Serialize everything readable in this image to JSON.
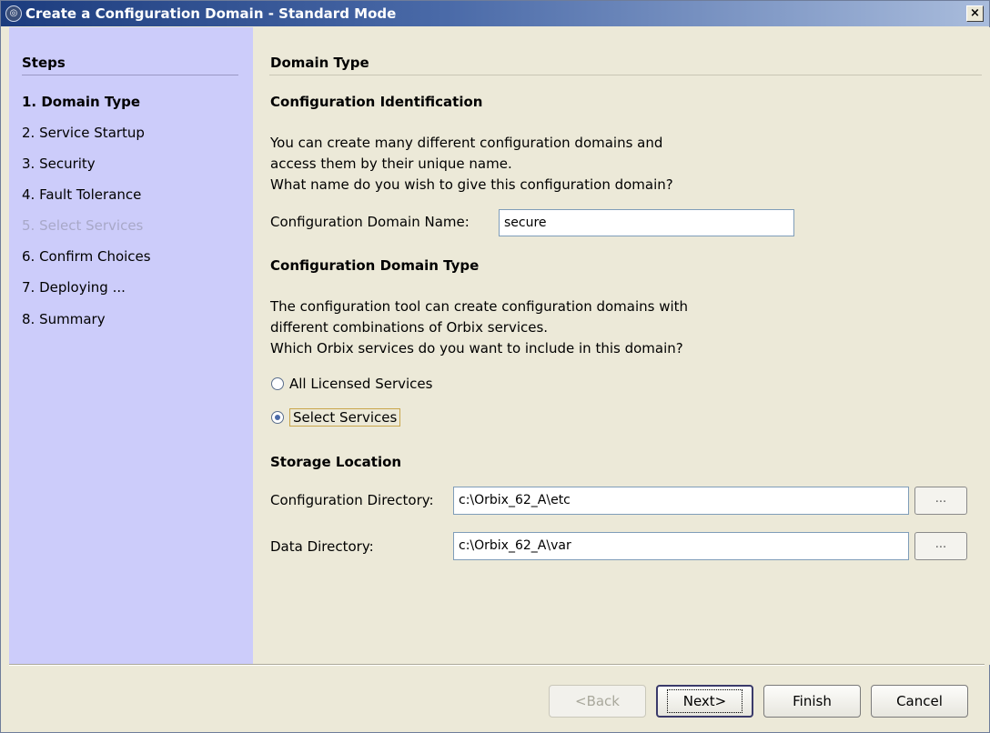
{
  "window": {
    "title": "Create a Configuration Domain - Standard Mode",
    "close_label": "×"
  },
  "sidebar": {
    "heading": "Steps",
    "steps": [
      {
        "label": "1. Domain Type",
        "state": "active"
      },
      {
        "label": "2. Service Startup",
        "state": "normal"
      },
      {
        "label": "3. Security",
        "state": "normal"
      },
      {
        "label": "4. Fault Tolerance",
        "state": "normal"
      },
      {
        "label": "5. Select Services",
        "state": "disabled"
      },
      {
        "label": "6. Confirm Choices",
        "state": "normal"
      },
      {
        "label": "7. Deploying ...",
        "state": "normal"
      },
      {
        "label": "8. Summary",
        "state": "normal"
      }
    ]
  },
  "main": {
    "page_title": "Domain Type",
    "identification": {
      "heading": "Configuration Identification",
      "lines": [
        "You can create many different configuration domains and",
        "access them by their unique name.",
        "What name do you wish to give this configuration domain?"
      ],
      "name_label": "Configuration Domain Name:",
      "name_value": "secure"
    },
    "domain_type": {
      "heading": "Configuration Domain Type",
      "lines": [
        "The configuration tool can create configuration domains with",
        "different combinations of Orbix services.",
        "Which Orbix services do you want to include in this domain?"
      ],
      "option_all": "All Licensed Services",
      "option_select": "Select Services",
      "selected": "Select Services"
    },
    "storage": {
      "heading": "Storage Location",
      "config_dir_label": "Configuration Directory:",
      "config_dir_value": "c:\\Orbix_62_A\\etc",
      "data_dir_label": "Data Directory:",
      "data_dir_value": "c:\\Orbix_62_A\\var",
      "browse_label": "..."
    }
  },
  "footer": {
    "back_label": "<Back",
    "next_label": "Next>",
    "finish_label": "Finish",
    "cancel_label": "Cancel"
  }
}
